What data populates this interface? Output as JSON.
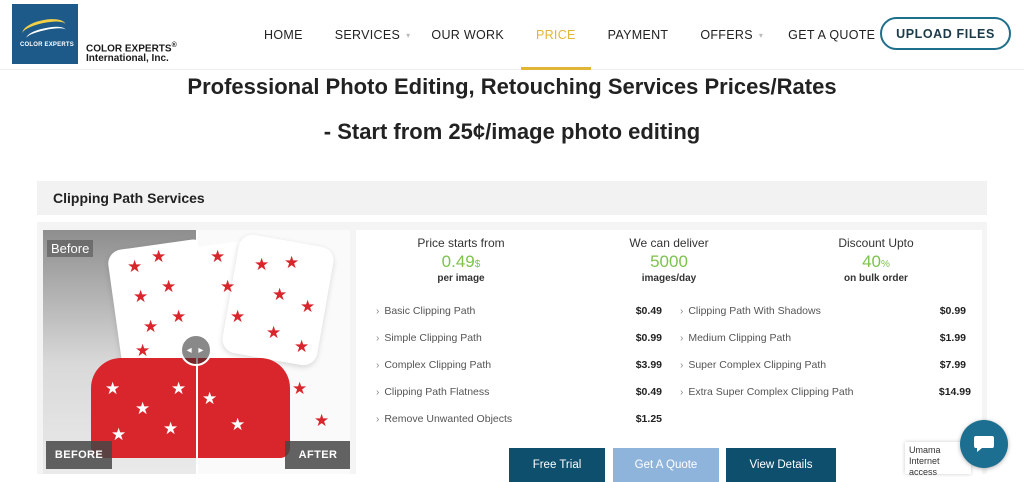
{
  "brand": {
    "logo_inner": "COLOR EXPERTS",
    "name_line1": "COLOR EXPERTS",
    "name_mark": "®",
    "name_line2": "International, Inc."
  },
  "nav": {
    "items": [
      {
        "label": "HOME"
      },
      {
        "label": "SERVICES"
      },
      {
        "label": "OUR WORK"
      },
      {
        "label": "PRICE"
      },
      {
        "label": "PAYMENT"
      },
      {
        "label": "OFFERS"
      },
      {
        "label": "GET A QUOTE"
      }
    ],
    "active": "PRICE",
    "accent": "#e2b536"
  },
  "upload_label": "UPLOAD FILES",
  "page_title_line1": "Professional Photo Editing, Retouching Services Prices/Rates",
  "page_title_line2": "- Start from 25¢/image photo editing",
  "section": {
    "title": "Clipping Path Services",
    "image": {
      "before_tag": "Before",
      "before_label": "BEFORE",
      "after_label": "AFTER",
      "handle": "◂ ▸"
    },
    "stats": [
      {
        "heading": "Price starts from",
        "value": "0.49",
        "unit": "$",
        "sub": "per image"
      },
      {
        "heading": "We can deliver",
        "value": "5000",
        "unit": "",
        "sub": "images/day"
      },
      {
        "heading": "Discount Upto",
        "value": "40",
        "unit": "%",
        "sub": "on bulk order"
      }
    ],
    "services_left": [
      {
        "name": "Basic Clipping Path",
        "price": "$0.49"
      },
      {
        "name": "Simple Clipping Path",
        "price": "$0.99"
      },
      {
        "name": "Complex Clipping Path",
        "price": "$3.99"
      },
      {
        "name": "Clipping Path Flatness",
        "price": "$0.49"
      },
      {
        "name": "Remove Unwanted Objects",
        "price": "$1.25"
      }
    ],
    "services_right": [
      {
        "name": "Clipping Path With Shadows",
        "price": "$0.99"
      },
      {
        "name": "Medium Clipping Path",
        "price": "$1.99"
      },
      {
        "name": "Super Complex Clipping Path",
        "price": "$7.99"
      },
      {
        "name": "Extra Super Complex Clipping Path",
        "price": "$14.99"
      }
    ],
    "buttons": [
      {
        "label": "Free Trial",
        "color": "#0f4f6e"
      },
      {
        "label": "Get A Quote",
        "color": "#8fb4dc"
      },
      {
        "label": "View Details",
        "color": "#0f4f6e"
      }
    ]
  },
  "chat": {
    "line1": "Umama",
    "line2": "Internet access"
  },
  "colors": {
    "green_value": "#7dc24e",
    "upload_border": "#1e6f8c",
    "chat": "#1c6f90"
  },
  "icons": {
    "service_arrow": "›",
    "nav_caret": "chevron-down-icon",
    "chat": "chat-icon"
  }
}
